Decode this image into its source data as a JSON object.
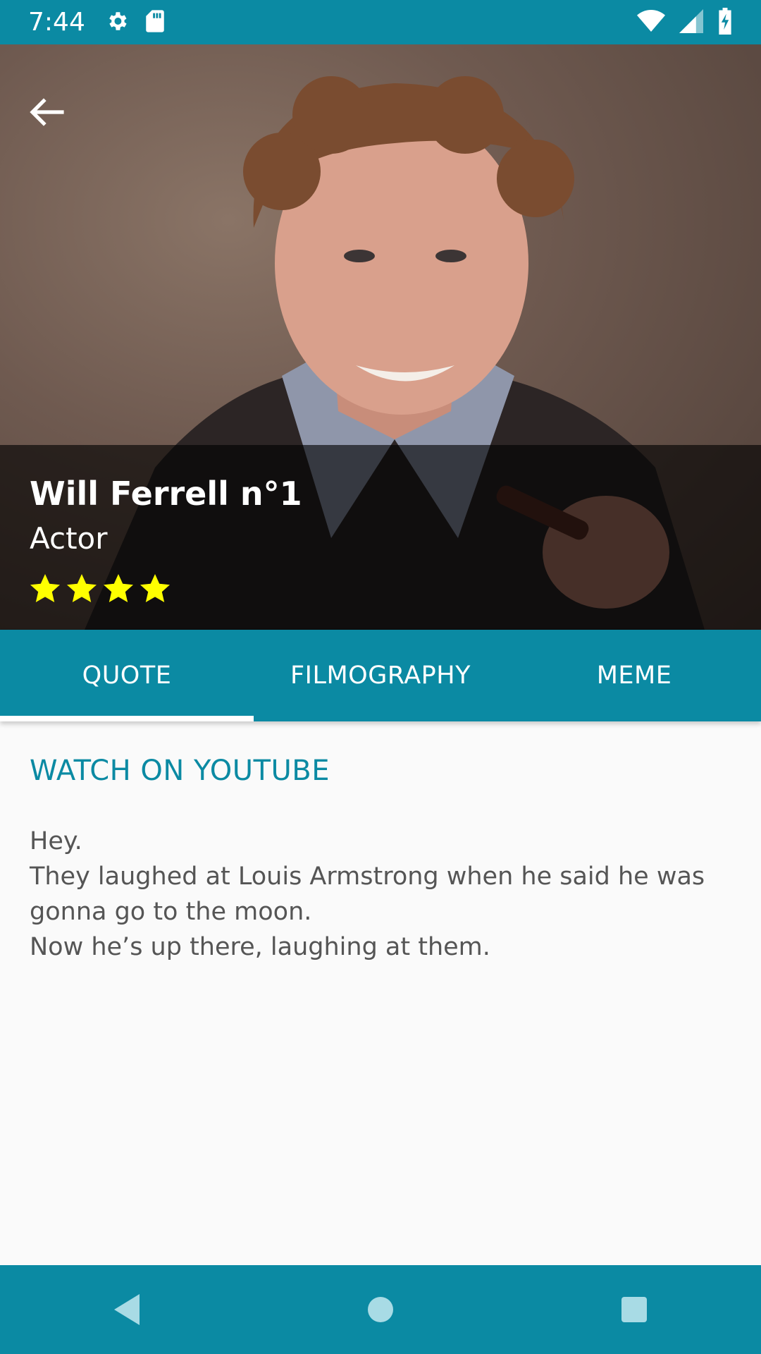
{
  "status_bar": {
    "time": "7:44",
    "icons": [
      "settings-icon",
      "sd-card-icon",
      "wifi-icon",
      "signal-icon",
      "battery-charging-icon"
    ]
  },
  "hero": {
    "name": "Will Ferrell n°1",
    "role": "Actor",
    "rating": {
      "stars": 4,
      "max": 4
    },
    "back_icon": "arrow-back-icon"
  },
  "tabs": [
    {
      "label": "QUOTE",
      "active": true
    },
    {
      "label": "FILMOGRAPHY",
      "active": false
    },
    {
      "label": "MEME",
      "active": false
    }
  ],
  "content": {
    "link": "WATCH ON YOUTUBE",
    "quote_lines": [
      "Hey.",
      "They laughed at Louis Armstrong when he said he was",
      "gonna go to the moon.",
      "Now he’s up there, laughing at them."
    ]
  },
  "nav": [
    "back-triangle-icon",
    "home-circle-icon",
    "recents-square-icon"
  ],
  "colors": {
    "accent": "#0b8aa3",
    "star": "#ffff00"
  }
}
